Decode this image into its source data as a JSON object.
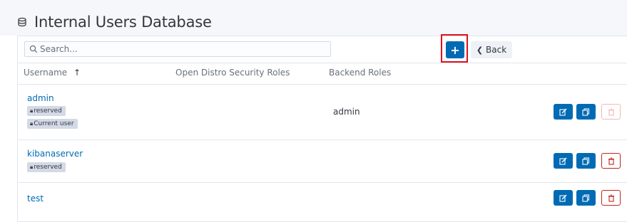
{
  "page": {
    "title": "Internal Users Database",
    "title_icon": "database-icon"
  },
  "toolbar": {
    "search_placeholder": "Search...",
    "add_label": "+",
    "back_label": "Back"
  },
  "table": {
    "columns": [
      "Username",
      "Open Distro Security Roles",
      "Backend Roles"
    ],
    "sort_indicator": "↑",
    "rows": [
      {
        "username": "admin",
        "badges": [
          "reserved",
          "Current user"
        ],
        "security_roles": "",
        "backend_roles": "admin",
        "delete_enabled": false
      },
      {
        "username": "kibanaserver",
        "badges": [
          "reserved"
        ],
        "security_roles": "",
        "backend_roles": "",
        "delete_enabled": true
      },
      {
        "username": "test",
        "badges": [],
        "security_roles": "",
        "backend_roles": "",
        "delete_enabled": true
      }
    ]
  },
  "colors": {
    "primary": "#006bb4",
    "danger": "#bd271e",
    "highlight": "#e0101d"
  }
}
